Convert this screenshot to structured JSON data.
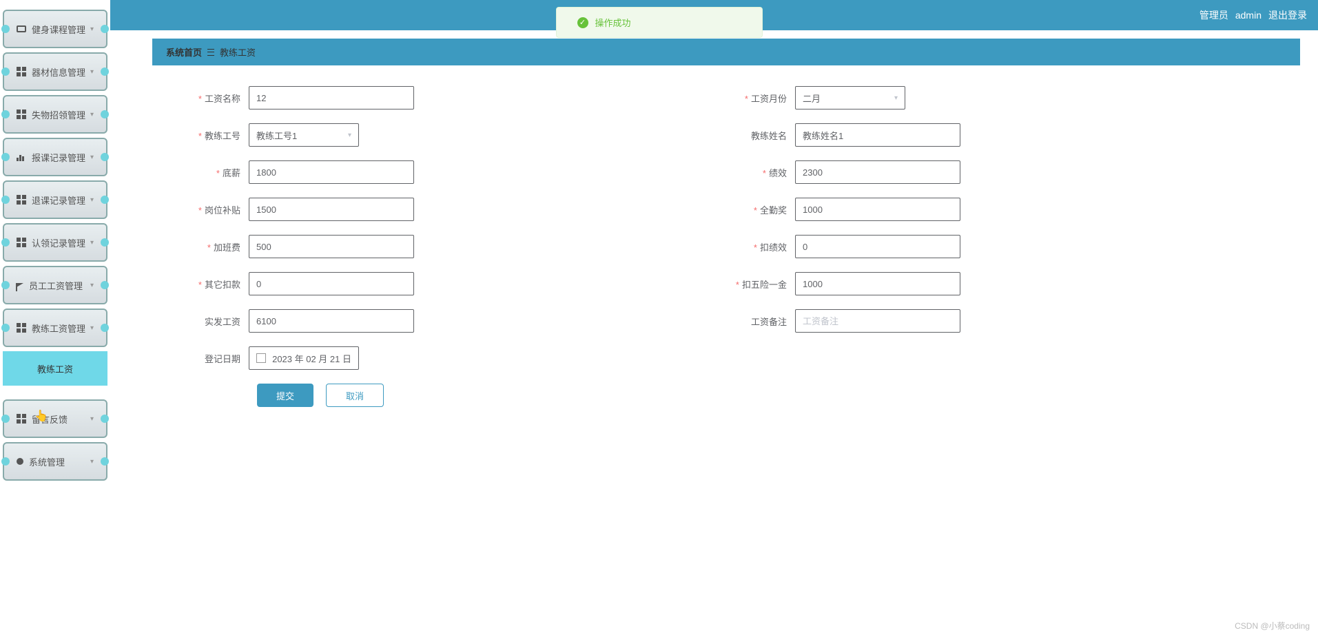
{
  "header": {
    "role_label": "管理员",
    "username": "admin",
    "logout": "退出登录"
  },
  "toast": {
    "message": "操作成功"
  },
  "sidebar": {
    "items": [
      {
        "label": "健身课程管理",
        "icon": "monitor-icon"
      },
      {
        "label": "器材信息管理",
        "icon": "grid-icon"
      },
      {
        "label": "失物招领管理",
        "icon": "grid-icon"
      },
      {
        "label": "报课记录管理",
        "icon": "chart-icon"
      },
      {
        "label": "退课记录管理",
        "icon": "grid-icon"
      },
      {
        "label": "认领记录管理",
        "icon": "grid-icon"
      },
      {
        "label": "员工工资管理",
        "icon": "flag-icon"
      },
      {
        "label": "教练工资管理",
        "icon": "grid-icon"
      },
      {
        "label": "留言反馈",
        "icon": "grid-icon"
      },
      {
        "label": "系统管理",
        "icon": "dot-icon"
      }
    ],
    "submenu": {
      "label": "教练工资"
    }
  },
  "breadcrumb": {
    "home": "系统首页",
    "current": "教练工资"
  },
  "form": {
    "salary_name": {
      "label": "工资名称",
      "value": "12"
    },
    "salary_month": {
      "label": "工资月份",
      "value": "二月"
    },
    "coach_id": {
      "label": "教练工号",
      "value": "教练工号1"
    },
    "coach_name": {
      "label": "教练姓名",
      "value": "教练姓名1"
    },
    "base_salary": {
      "label": "底薪",
      "value": "1800"
    },
    "performance": {
      "label": "绩效",
      "value": "2300"
    },
    "post_subsidy": {
      "label": "岗位补贴",
      "value": "1500"
    },
    "attendance_bonus": {
      "label": "全勤奖",
      "value": "1000"
    },
    "overtime": {
      "label": "加班费",
      "value": "500"
    },
    "deduct_perf": {
      "label": "扣绩效",
      "value": "0"
    },
    "other_deduct": {
      "label": "其它扣款",
      "value": "0"
    },
    "insurance": {
      "label": "扣五险一金",
      "value": "1000"
    },
    "actual_pay": {
      "label": "实发工资",
      "value": "6100"
    },
    "remark": {
      "label": "工资备注",
      "placeholder": "工资备注"
    },
    "reg_date": {
      "label": "登记日期",
      "value": "2023 年 02 月 21 日"
    }
  },
  "buttons": {
    "submit": "提交",
    "cancel": "取消"
  },
  "watermark": "CSDN @小蔡coding"
}
